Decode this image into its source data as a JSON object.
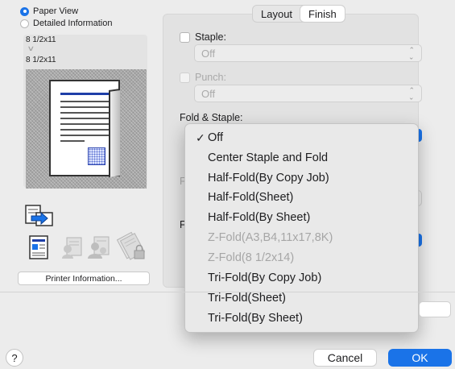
{
  "view_options": {
    "paper_view": "Paper View",
    "detailed_information": "Detailed Information",
    "selected": "paper_view"
  },
  "paper_info": {
    "original_size": "8 1/2x11",
    "output_size": "8 1/2x11"
  },
  "printer_information_button": "Printer Information...",
  "tabs": [
    {
      "label": "Layout",
      "active": false
    },
    {
      "label": "Finish",
      "active": true
    }
  ],
  "staple": {
    "label": "Staple:",
    "value": "Off"
  },
  "punch": {
    "label": "Punch:",
    "value": "Off"
  },
  "fold_staple": {
    "label": "Fold & Staple:"
  },
  "dropdown": {
    "items": [
      {
        "label": "Off",
        "checked": true,
        "enabled": true
      },
      {
        "label": "Center Staple and Fold",
        "checked": false,
        "enabled": true
      },
      {
        "label": "Half-Fold(By Copy Job)",
        "checked": false,
        "enabled": true
      },
      {
        "label": "Half-Fold(Sheet)",
        "checked": false,
        "enabled": true
      },
      {
        "label": "Half-Fold(By Sheet)",
        "checked": false,
        "enabled": true
      },
      {
        "label": "Z-Fold(A3,B4,11x17,8K)",
        "checked": false,
        "enabled": false
      },
      {
        "label": "Z-Fold(8 1/2x14)",
        "checked": false,
        "enabled": false
      },
      {
        "label": "Tri-Fold(By Copy Job)",
        "checked": false,
        "enabled": true
      },
      {
        "label": "Tri-Fold(Sheet)",
        "checked": false,
        "enabled": true
      },
      {
        "label": "Tri-Fold(By Sheet)",
        "checked": false,
        "enabled": true
      }
    ]
  },
  "bottom": {
    "help_label": "?",
    "cancel_label": "Cancel",
    "ok_label": "OK"
  },
  "colors": {
    "accent": "#1a73e8",
    "window_bg": "#ececec"
  }
}
